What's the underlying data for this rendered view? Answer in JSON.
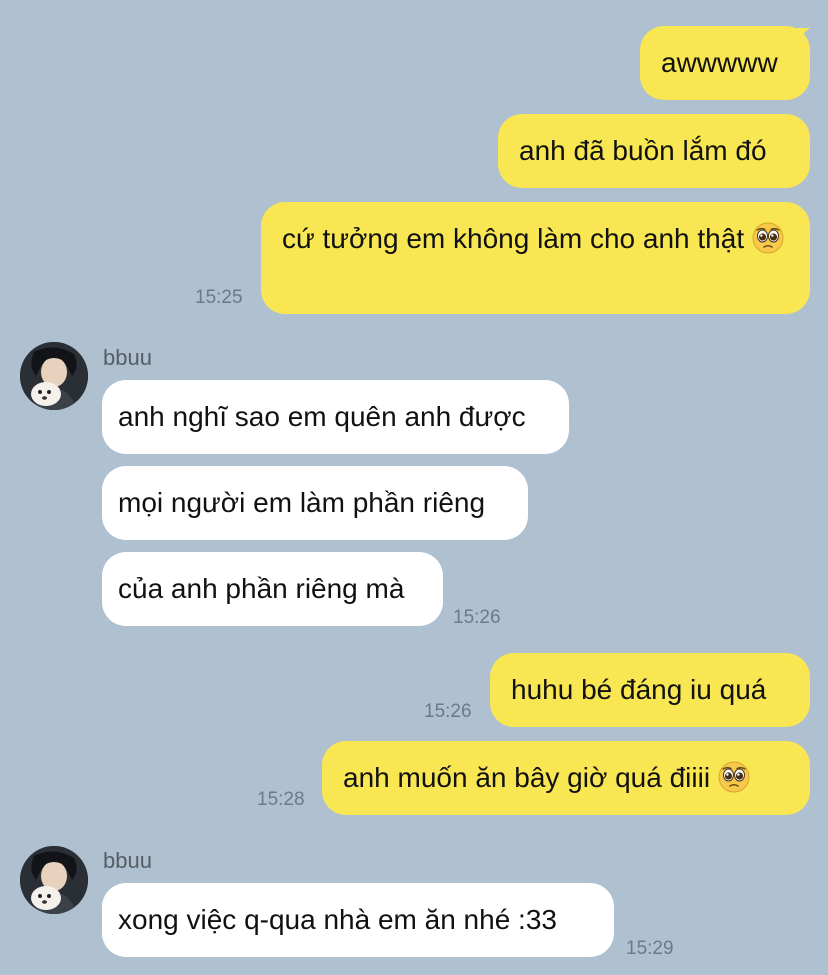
{
  "conversation": {
    "messages": [
      {
        "id": "m1",
        "direction": "out",
        "text": "awwwww"
      },
      {
        "id": "m2",
        "direction": "out",
        "text": "anh đã buồn lắm đó"
      },
      {
        "id": "m3",
        "direction": "out",
        "text": "cứ tưởng em không làm cho anh thật",
        "emoji": "pleading-face-emoji",
        "time": "15:25"
      },
      {
        "id": "m4",
        "direction": "in",
        "sender": "bbuu",
        "text": "anh nghĩ sao em quên anh được"
      },
      {
        "id": "m5",
        "direction": "in",
        "text": "mọi người em làm phần riêng"
      },
      {
        "id": "m6",
        "direction": "in",
        "text": "của anh phần riêng mà",
        "time": "15:26"
      },
      {
        "id": "m7",
        "direction": "out",
        "text": "huhu bé đáng iu quá",
        "time": "15:26"
      },
      {
        "id": "m8",
        "direction": "out",
        "text": "anh muốn ăn bây giờ quá điiii",
        "emoji": "pleading-face-emoji",
        "time": "15:28"
      },
      {
        "id": "m9",
        "direction": "in",
        "sender": "bbuu",
        "text": "xong việc q-qua nhà em ăn nhé :33",
        "time": "15:29"
      }
    ]
  },
  "colors": {
    "background": "#AFC0D0",
    "outgoing_bubble": "#F8E652",
    "incoming_bubble": "#FFFFFF",
    "timestamp": "#6B7A88"
  }
}
